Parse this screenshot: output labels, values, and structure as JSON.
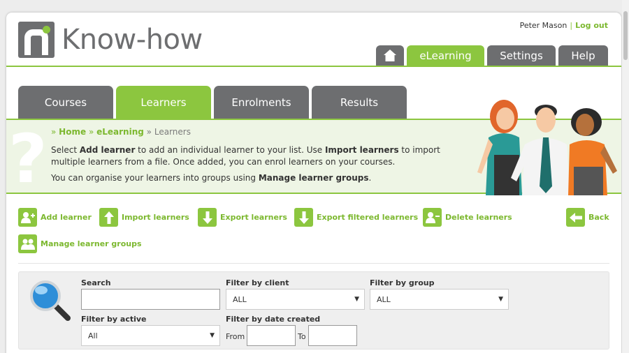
{
  "brand": {
    "name": "Know-how"
  },
  "user": {
    "name": "Peter Mason",
    "sep": "|",
    "logout": "Log out"
  },
  "top_tabs": [
    {
      "label": "eLearning"
    },
    {
      "label": "Settings"
    },
    {
      "label": "Help"
    }
  ],
  "sub_tabs": [
    {
      "label": "Courses"
    },
    {
      "label": "Learners"
    },
    {
      "label": "Enrolments"
    },
    {
      "label": "Results"
    }
  ],
  "breadcrumb": {
    "home": "Home",
    "elearning": "eLearning",
    "current": "Learners",
    "sep": "»"
  },
  "intro": {
    "p1_a": "Select ",
    "p1_b": "Add learner",
    "p1_c": " to add an individual learner to your list. Use ",
    "p1_d": "Import learners",
    "p1_e": " to import multiple learners from a file. Once added, you can enrol learners on your courses.",
    "p2_a": "You can organise your learners into groups using ",
    "p2_b": "Manage learner groups",
    "p2_c": "."
  },
  "actions": [
    {
      "label": "Add learner",
      "icon": "add-user-icon"
    },
    {
      "label": "Import learners",
      "icon": "arrow-up-icon"
    },
    {
      "label": "Export learners",
      "icon": "arrow-down-icon"
    },
    {
      "label": "Export filtered learners",
      "icon": "arrow-down-icon"
    },
    {
      "label": "Delete learners",
      "icon": "remove-user-icon"
    },
    {
      "label": "Back",
      "icon": "arrow-left-icon"
    },
    {
      "label": "Manage learner groups",
      "icon": "group-icon"
    }
  ],
  "filters": {
    "search_label": "Search",
    "search_value": "",
    "client_label": "Filter by client",
    "client_value": "ALL",
    "group_label": "Filter by group",
    "group_value": "ALL",
    "active_label": "Filter by active",
    "active_value": "All",
    "date_label": "Filter by date created",
    "from_label": "From",
    "to_label": "To",
    "from_value": "",
    "to_value": ""
  },
  "colors": {
    "accent": "#8cc63f",
    "dark_tab": "#6d6e70",
    "banner_bg": "#eef5e5"
  }
}
